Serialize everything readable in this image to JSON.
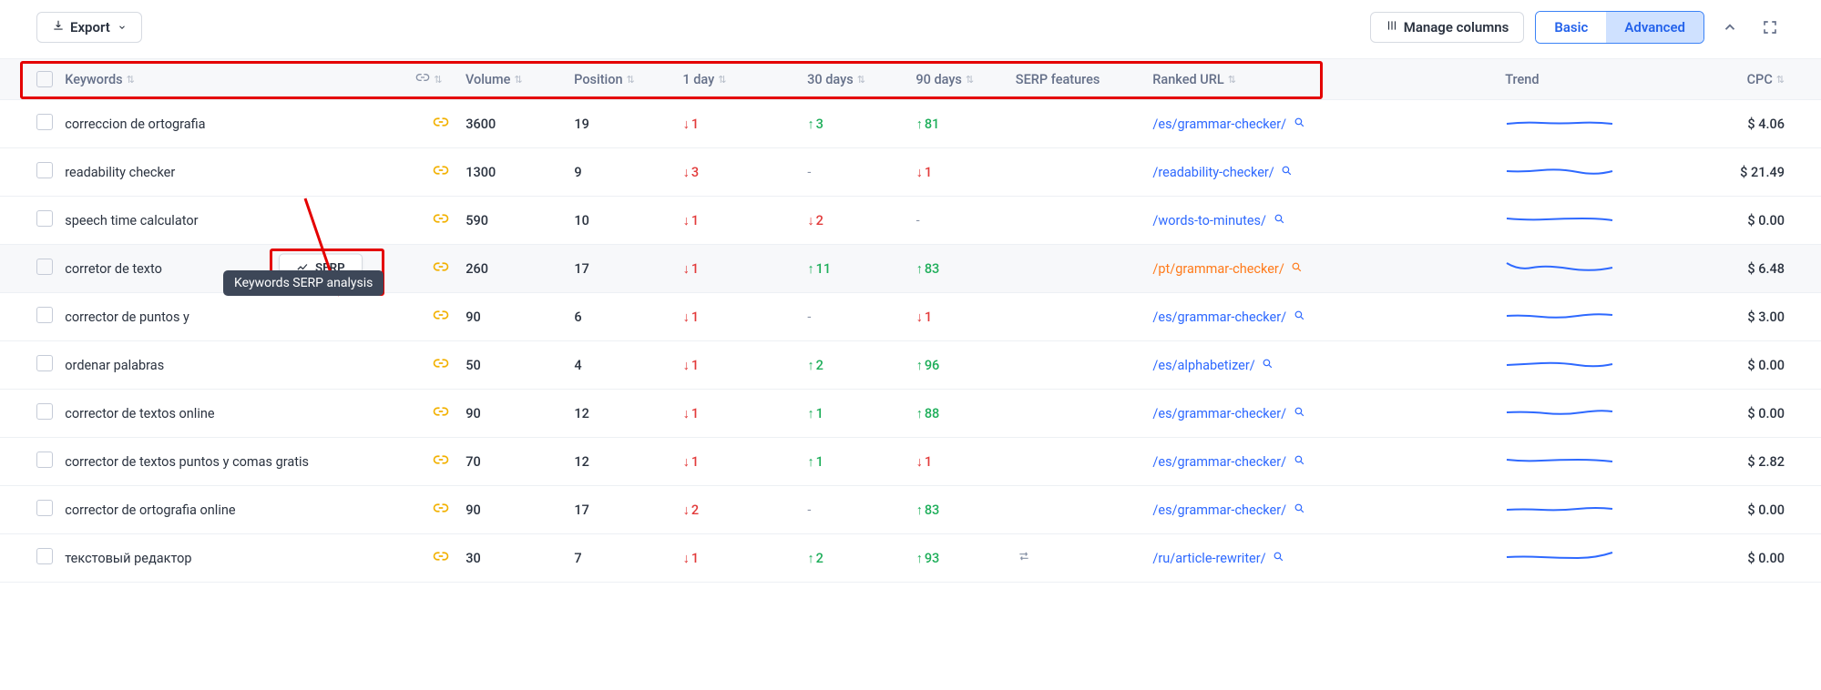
{
  "toolbar": {
    "export_label": "Export",
    "manage_columns_label": "Manage columns",
    "basic_label": "Basic",
    "advanced_label": "Advanced"
  },
  "columns": {
    "keywords": "Keywords",
    "volume": "Volume",
    "position": "Position",
    "d1": "1 day",
    "d30": "30 days",
    "d90": "90 days",
    "serp_features": "SERP features",
    "ranked_url": "Ranked URL",
    "trend": "Trend",
    "cpc": "CPC"
  },
  "serp_button_label": "SERP",
  "serp_tooltip": "Keywords SERP analysis",
  "rows": [
    {
      "keyword": "correccion de ortografia",
      "volume": "3600",
      "position": "19",
      "d1": {
        "t": "down",
        "v": "1"
      },
      "d30": {
        "t": "up",
        "v": "3"
      },
      "d90": {
        "t": "up",
        "v": "81"
      },
      "serp_icon": null,
      "url": "/es/grammar-checker/",
      "url_color": "blue",
      "cpc": "$ 4.06"
    },
    {
      "keyword": "readability checker",
      "volume": "1300",
      "position": "9",
      "d1": {
        "t": "down",
        "v": "3"
      },
      "d30": {
        "t": "dash"
      },
      "d90": {
        "t": "down",
        "v": "1"
      },
      "serp_icon": null,
      "url": "/readability-checker/",
      "url_color": "blue",
      "cpc": "$ 21.49"
    },
    {
      "keyword": "speech time calculator",
      "volume": "590",
      "position": "10",
      "d1": {
        "t": "down",
        "v": "1"
      },
      "d30": {
        "t": "down",
        "v": "2"
      },
      "d90": {
        "t": "dash"
      },
      "serp_icon": null,
      "url": "/words-to-minutes/",
      "url_color": "blue",
      "cpc": "$ 0.00"
    },
    {
      "keyword": "corretor de texto",
      "volume": "260",
      "position": "17",
      "d1": {
        "t": "down",
        "v": "1"
      },
      "d30": {
        "t": "up",
        "v": "11"
      },
      "d90": {
        "t": "up",
        "v": "83"
      },
      "serp_icon": null,
      "url": "/pt/grammar-checker/",
      "url_color": "orange",
      "cpc": "$ 6.48",
      "hovered": true,
      "show_serp": true,
      "show_tooltip_below": true
    },
    {
      "keyword": "corrector de puntos y",
      "volume": "90",
      "position": "6",
      "d1": {
        "t": "down",
        "v": "1"
      },
      "d30": {
        "t": "dash"
      },
      "d90": {
        "t": "down",
        "v": "1"
      },
      "serp_icon": null,
      "url": "/es/grammar-checker/",
      "url_color": "blue",
      "cpc": "$ 3.00",
      "tooltip_overlay": true
    },
    {
      "keyword": "ordenar palabras",
      "volume": "50",
      "position": "4",
      "d1": {
        "t": "down",
        "v": "1"
      },
      "d30": {
        "t": "up",
        "v": "2"
      },
      "d90": {
        "t": "up",
        "v": "96"
      },
      "serp_icon": null,
      "url": "/es/alphabetizer/",
      "url_color": "blue",
      "cpc": "$ 0.00"
    },
    {
      "keyword": "corrector de textos online",
      "volume": "90",
      "position": "12",
      "d1": {
        "t": "down",
        "v": "1"
      },
      "d30": {
        "t": "up",
        "v": "1"
      },
      "d90": {
        "t": "up",
        "v": "88"
      },
      "serp_icon": null,
      "url": "/es/grammar-checker/",
      "url_color": "blue",
      "cpc": "$ 0.00"
    },
    {
      "keyword": "corrector de textos puntos y comas gratis",
      "volume": "70",
      "position": "12",
      "d1": {
        "t": "down",
        "v": "1"
      },
      "d30": {
        "t": "up",
        "v": "1"
      },
      "d90": {
        "t": "down",
        "v": "1"
      },
      "serp_icon": null,
      "url": "/es/grammar-checker/",
      "url_color": "blue",
      "cpc": "$ 2.82"
    },
    {
      "keyword": "corrector de ortografia online",
      "volume": "90",
      "position": "17",
      "d1": {
        "t": "down",
        "v": "2"
      },
      "d30": {
        "t": "dash"
      },
      "d90": {
        "t": "up",
        "v": "83"
      },
      "serp_icon": null,
      "url": "/es/grammar-checker/",
      "url_color": "blue",
      "cpc": "$ 0.00"
    },
    {
      "keyword": "текстовый редактор",
      "volume": "30",
      "position": "7",
      "d1": {
        "t": "down",
        "v": "1"
      },
      "d30": {
        "t": "up",
        "v": "2"
      },
      "d90": {
        "t": "up",
        "v": "93"
      },
      "serp_icon": "swap",
      "url": "/ru/article-rewriter/",
      "url_color": "blue",
      "cpc": "$ 0.00"
    }
  ]
}
